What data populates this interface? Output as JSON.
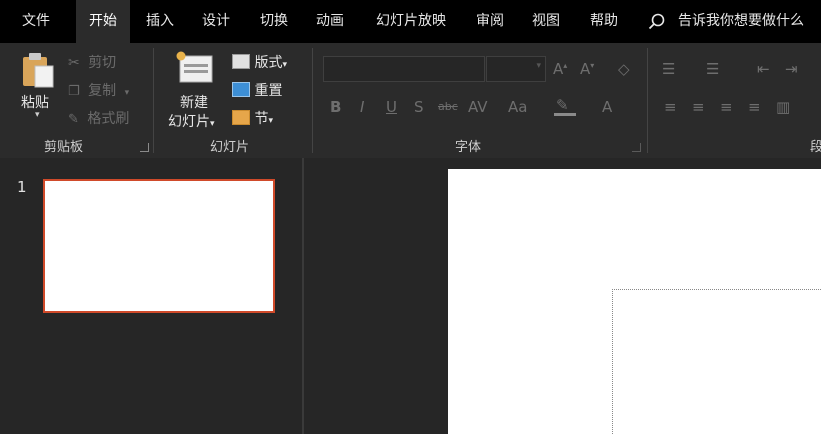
{
  "menu": {
    "tabs": [
      "文件",
      "开始",
      "插入",
      "设计",
      "切换",
      "动画",
      "幻灯片放映",
      "审阅",
      "视图",
      "帮助"
    ],
    "active_index": 1,
    "search_text": "告诉我你想要做什么"
  },
  "clipboard": {
    "paste": "粘贴",
    "cut": "剪切",
    "copy": "复制",
    "format_painter": "格式刷",
    "label": "剪贴板"
  },
  "slides_group": {
    "new_slide_line1": "新建",
    "new_slide_line2": "幻灯片",
    "layout": "版式",
    "reset": "重置",
    "section": "节",
    "label": "幻灯片"
  },
  "font_group": {
    "label": "字体"
  },
  "paragraph_group": {
    "label": "段"
  },
  "thumbnails": {
    "slide_number": "1"
  },
  "colors": {
    "accent": "#d04a2a"
  }
}
